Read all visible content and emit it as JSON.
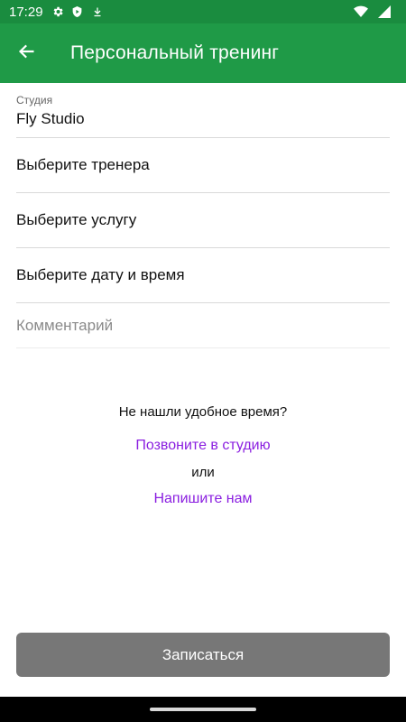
{
  "status_bar": {
    "time": "17:29",
    "icons": [
      "gear-icon",
      "shield-icon",
      "download-icon",
      "wifi-icon",
      "cellular-signal-icon"
    ]
  },
  "app_bar": {
    "title": "Персональный тренинг",
    "back_icon": "arrow-left-icon",
    "color": "#1f9a47"
  },
  "form": {
    "studio": {
      "label": "Студия",
      "value": "Fly Studio"
    },
    "trainer": {
      "label": "Выберите тренера"
    },
    "service": {
      "label": "Выберите услугу"
    },
    "datetime": {
      "label": "Выберите дату и время"
    },
    "comment": {
      "placeholder": "Комментарий",
      "value": ""
    }
  },
  "help": {
    "question": "Не нашли удобное время?",
    "call_link": "Позвоните в студию",
    "or": "или",
    "write_link": "Напишите нам",
    "link_color": "#8a1ee0"
  },
  "submit": {
    "label": "Записаться",
    "color": "#777777"
  }
}
